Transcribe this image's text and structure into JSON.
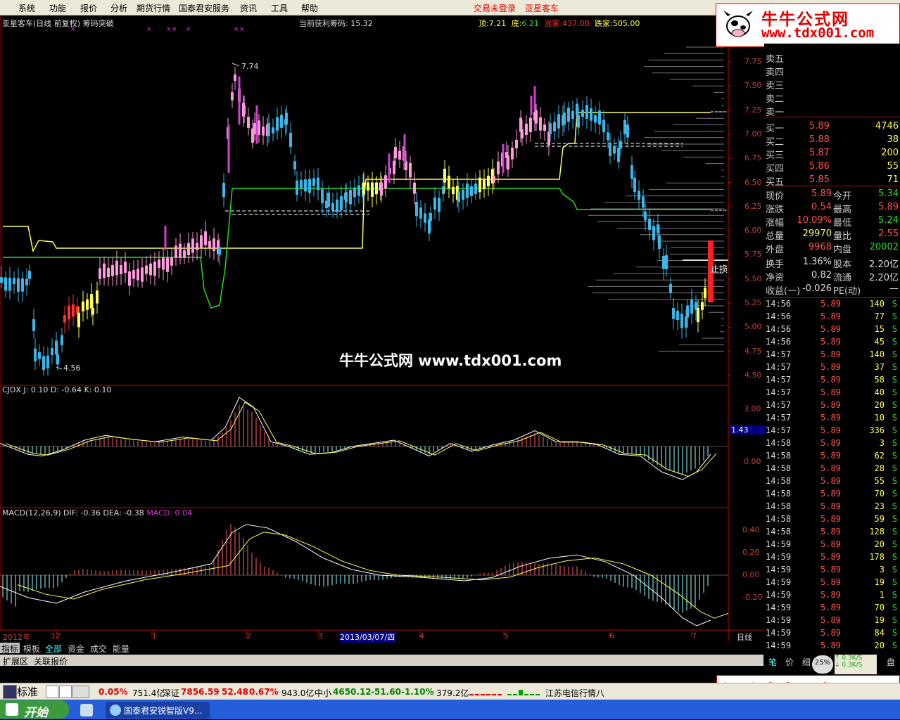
{
  "menu": {
    "items": [
      "系统",
      "功能",
      "报价",
      "分析",
      "期货行情",
      "国泰君安服务",
      "资讯",
      "工具",
      "帮助"
    ],
    "status_login": "交易未登录",
    "status_client": "亚星客车"
  },
  "logo": {
    "title": "牛牛公式网",
    "url": "www.tdx001.com"
  },
  "watermark": "牛牛公式网 www.tdx001.com",
  "chart": {
    "title": "亚星客车(日线 前复权) 筹码突破",
    "profit_label": "当前获利筹码: 15.32",
    "top_label": "顶:",
    "top_val": "7.21",
    "bottom_label": "底:",
    "bottom_val": "6.21",
    "rise_label": "涨家:",
    "rise_val": "437.00",
    "fall_label": "跌家:",
    "fall_val": "505.00",
    "high_mark": "7.74",
    "low_mark": "4.56",
    "stop_label": "止损",
    "price_axis": [
      "7.75",
      "7.50",
      "7.25",
      "7.00",
      "6.75",
      "6.50",
      "6.25",
      "6.00",
      "5.75",
      "5.50",
      "5.25",
      "5.00",
      "4.75",
      "4.50"
    ],
    "cjdx_title": "CJDX J: 0.10  D: -0.64  K: 0.10",
    "cjdx_axis": [
      "3.00",
      "1.43",
      "0.00"
    ],
    "macd_title_a": "MACD(12,26,9)  DIF: -0.36  DEA: -0.38",
    "macd_title_b": "MACD: 0.04",
    "macd_axis": [
      "0.40",
      "0.20",
      "0.00",
      "-0.20"
    ],
    "date_axis": [
      "2012年",
      "12",
      "1",
      "2",
      "3",
      "2013/03/07/四",
      "4",
      "5",
      "6",
      "7"
    ],
    "period": "日线"
  },
  "chart_data": {
    "type": "candlestick",
    "title": "亚星客车(日线 前复权) 筹码突破",
    "y_range": [
      4.5,
      7.75
    ],
    "top_line": 7.21,
    "bottom_line": 6.21,
    "high": 7.74,
    "low": 4.56,
    "cjdx": {
      "J": 0.1,
      "D": -0.64,
      "K": 0.1,
      "marker": 1.43
    },
    "macd": {
      "params": [
        12,
        26,
        9
      ],
      "DIF": -0.36,
      "DEA": -0.38,
      "MACD": 0.04
    }
  },
  "tabs": [
    "指标",
    "模板",
    "全部",
    "资金",
    "成交",
    "能量"
  ],
  "tabs2": [
    "扩展区",
    "关联报价"
  ],
  "quote": {
    "sell": [
      {
        "label": "卖五"
      },
      {
        "label": "卖四"
      },
      {
        "label": "卖三"
      },
      {
        "label": "卖二"
      },
      {
        "label": "卖一"
      }
    ],
    "buy": [
      {
        "label": "买一",
        "price": "5.89",
        "vol": "4746"
      },
      {
        "label": "买二",
        "price": "5.88",
        "vol": "38"
      },
      {
        "label": "买三",
        "price": "5.87",
        "vol": "200"
      },
      {
        "label": "买四",
        "price": "5.86",
        "vol": "55"
      },
      {
        "label": "买五",
        "price": "5.85",
        "vol": "71"
      }
    ],
    "stats": [
      {
        "l1": "现价",
        "v1": "5.89",
        "l2": "今开",
        "v2": "5.34"
      },
      {
        "l1": "涨跌",
        "v1": "0.54",
        "l2": "最高",
        "v2": "5.89"
      },
      {
        "l1": "涨幅",
        "v1": "10.09%",
        "l2": "最低",
        "v2": "5.24"
      },
      {
        "l1": "总量",
        "v1": "29970",
        "l2": "量比",
        "v2": "2.55"
      },
      {
        "l1": "外盘",
        "v1": "9968",
        "l2": "内盘",
        "v2": "20002"
      },
      {
        "l1": "换手",
        "v1": "1.36%",
        "l2": "股本",
        "v2": "2.20亿"
      },
      {
        "l1": "净资",
        "v1": "0.82",
        "l2": "流通",
        "v2": "2.20亿"
      },
      {
        "l1": "收益(一)",
        "v1": "-0.026",
        "l2": "PE(动)",
        "v2": "—"
      }
    ]
  },
  "ticks": [
    {
      "t": "14:56",
      "p": "5.89",
      "v": "140",
      "s": "S"
    },
    {
      "t": "14:56",
      "p": "5.89",
      "v": "77",
      "s": "S"
    },
    {
      "t": "14:56",
      "p": "5.89",
      "v": "15",
      "s": "S"
    },
    {
      "t": "14:56",
      "p": "5.89",
      "v": "45",
      "s": "S"
    },
    {
      "t": "14:57",
      "p": "5.89",
      "v": "140",
      "s": "S"
    },
    {
      "t": "14:57",
      "p": "5.89",
      "v": "37",
      "s": "S"
    },
    {
      "t": "14:57",
      "p": "5.89",
      "v": "58",
      "s": "S"
    },
    {
      "t": "14:57",
      "p": "5.89",
      "v": "40",
      "s": "S"
    },
    {
      "t": "14:57",
      "p": "5.89",
      "v": "20",
      "s": "S"
    },
    {
      "t": "14:57",
      "p": "5.89",
      "v": "10",
      "s": "S"
    },
    {
      "t": "14:57",
      "p": "5.89",
      "v": "336",
      "s": "S"
    },
    {
      "t": "14:58",
      "p": "5.89",
      "v": "3",
      "s": "S"
    },
    {
      "t": "14:58",
      "p": "5.89",
      "v": "62",
      "s": "S"
    },
    {
      "t": "14:58",
      "p": "5.89",
      "v": "28",
      "s": "S"
    },
    {
      "t": "14:58",
      "p": "5.89",
      "v": "55",
      "s": "S"
    },
    {
      "t": "14:58",
      "p": "5.89",
      "v": "70",
      "s": "S"
    },
    {
      "t": "14:58",
      "p": "5.89",
      "v": "23",
      "s": "S"
    },
    {
      "t": "14:58",
      "p": "5.89",
      "v": "59",
      "s": "S"
    },
    {
      "t": "14:58",
      "p": "5.89",
      "v": "128",
      "s": "S"
    },
    {
      "t": "14:59",
      "p": "5.89",
      "v": "20",
      "s": "S"
    },
    {
      "t": "14:59",
      "p": "5.89",
      "v": "178",
      "s": "S"
    },
    {
      "t": "14:59",
      "p": "5.89",
      "v": "3",
      "s": "S"
    },
    {
      "t": "14:59",
      "p": "5.89",
      "v": "19",
      "s": "S"
    },
    {
      "t": "14:59",
      "p": "5.89",
      "v": "1",
      "s": "S"
    },
    {
      "t": "14:59",
      "p": "5.89",
      "v": "70",
      "s": "S"
    },
    {
      "t": "14:59",
      "p": "5.89",
      "v": "19",
      "s": "S"
    },
    {
      "t": "14:59",
      "p": "5.89",
      "v": "84",
      "s": "S"
    },
    {
      "t": "14:59",
      "p": "5.89",
      "v": "20",
      "s": "S"
    }
  ],
  "ticktabs": [
    "笔",
    "价",
    "细",
    "盘"
  ],
  "speed": {
    "pct": "25%",
    "up": "0.3K/S",
    "down": "0.3K/S"
  },
  "statusbar": {
    "mode": "标准",
    "sh_pct": "0.05%",
    "sh_amt": "751.4亿",
    "sz_label": "深证",
    "sz_val": "7856.59",
    "sz_chg": "52.48",
    "sz_pct": "0.67%",
    "sz_amt": "943.0亿",
    "zx_label": "中小",
    "zx_val": "4650.12",
    "zx_chg": "-51.60",
    "zx_pct": "-1.10%",
    "zx_amt": "379.2亿",
    "news": "江苏电信行情八"
  },
  "taskbar": {
    "start": "开始",
    "window": "国泰君安锐智版V9..."
  },
  "colors": {
    "up": "#ff5050",
    "down": "#54ffff",
    "cyan": "#3ab6e8",
    "pink": "#ff99dd",
    "magenta": "#d23fd2",
    "yellow": "#ffff55",
    "green": "#22dd22",
    "axis": "#c00000"
  }
}
